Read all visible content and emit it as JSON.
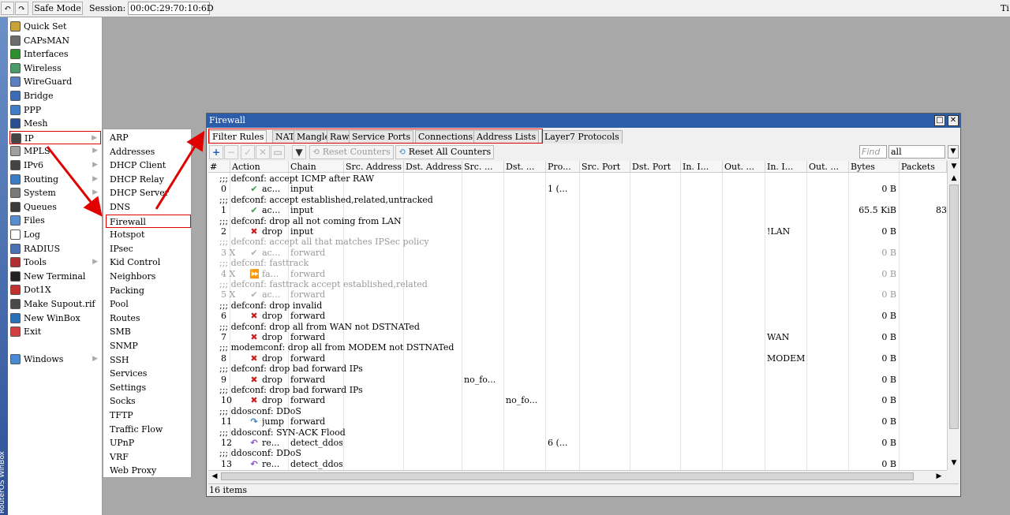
{
  "topbar": {
    "undo_icon": "↶",
    "redo_icon": "↷",
    "safe_mode": "Safe Mode",
    "session_label": "Session:",
    "session_value": "00:0C:29:70:10:6D",
    "right_text": "Ti"
  },
  "brand": "RouterOS WinBox",
  "sidebar": {
    "items": [
      {
        "label": "Quick Set",
        "icon": "quick-set-icon",
        "color": "#c9a33a",
        "arrow": false
      },
      {
        "label": "CAPsMAN",
        "icon": "capsman-icon",
        "color": "#6c6c6c",
        "arrow": false
      },
      {
        "label": "Interfaces",
        "icon": "interfaces-icon",
        "color": "#2f8f2f",
        "arrow": false
      },
      {
        "label": "Wireless",
        "icon": "wireless-icon",
        "color": "#4a9a6a",
        "arrow": false
      },
      {
        "label": "WireGuard",
        "icon": "wireguard-icon",
        "color": "#5b7fc0",
        "arrow": false
      },
      {
        "label": "Bridge",
        "icon": "bridge-icon",
        "color": "#3b6cb5",
        "arrow": false
      },
      {
        "label": "PPP",
        "icon": "ppp-icon",
        "color": "#3f7ec4",
        "arrow": false
      },
      {
        "label": "Mesh",
        "icon": "mesh-icon",
        "color": "#2a4f8f",
        "arrow": false
      },
      {
        "label": "IP",
        "icon": "ip-icon",
        "color": "#444444",
        "arrow": true
      },
      {
        "label": "MPLS",
        "icon": "mpls-icon",
        "color": "#a0a0a0",
        "arrow": true
      },
      {
        "label": "IPv6",
        "icon": "ipv6-icon",
        "color": "#444444",
        "arrow": true
      },
      {
        "label": "Routing",
        "icon": "routing-icon",
        "color": "#3b7dc4",
        "arrow": true
      },
      {
        "label": "System",
        "icon": "system-icon",
        "color": "#7a7a7a",
        "arrow": true
      },
      {
        "label": "Queues",
        "icon": "queues-icon",
        "color": "#3a3a3a",
        "arrow": false
      },
      {
        "label": "Files",
        "icon": "files-icon",
        "color": "#5a8cd0",
        "arrow": false
      },
      {
        "label": "Log",
        "icon": "log-icon",
        "color": "#ffffff",
        "arrow": false
      },
      {
        "label": "RADIUS",
        "icon": "radius-icon",
        "color": "#4b6fb0",
        "arrow": false
      },
      {
        "label": "Tools",
        "icon": "tools-icon",
        "color": "#b03030",
        "arrow": true
      },
      {
        "label": "New Terminal",
        "icon": "terminal-icon",
        "color": "#222222",
        "arrow": false
      },
      {
        "label": "Dot1X",
        "icon": "dot1x-icon",
        "color": "#c03030",
        "arrow": false
      },
      {
        "label": "Make Supout.rif",
        "icon": "supout-icon",
        "color": "#4a4a4a",
        "arrow": false
      },
      {
        "label": "New WinBox",
        "icon": "winbox-icon",
        "color": "#2a6fb8",
        "arrow": false
      },
      {
        "label": "Exit",
        "icon": "exit-icon",
        "color": "#d04040",
        "arrow": false
      }
    ],
    "windows_label": "Windows",
    "windows_icon": "windows-icon"
  },
  "submenu": {
    "items": [
      "ARP",
      "Addresses",
      "DHCP Client",
      "DHCP Relay",
      "DHCP Server",
      "DNS",
      "Firewall",
      "Hotspot",
      "IPsec",
      "Kid Control",
      "Neighbors",
      "Packing",
      "Pool",
      "Routes",
      "SMB",
      "SNMP",
      "SSH",
      "Services",
      "Settings",
      "Socks",
      "TFTP",
      "Traffic Flow",
      "UPnP",
      "VRF",
      "Web Proxy"
    ]
  },
  "firewall": {
    "title": "Firewall",
    "tabs": [
      "Filter Rules",
      "NAT",
      "Mangle",
      "Raw",
      "Service Ports",
      "Connections",
      "Address Lists",
      "Layer7 Protocols"
    ],
    "active_tab": "Filter Rules",
    "toolbar": {
      "reset_counters": "Reset Counters",
      "reset_all_counters": "Reset All Counters",
      "find_placeholder": "Find",
      "filter_value": "all"
    },
    "columns": [
      "#",
      "Action",
      "Chain",
      "Src. Address",
      "Dst. Address",
      "Src. ...",
      "Dst. ...",
      "Pro...",
      "Src. Port",
      "Dst. Port",
      "In. I...",
      "Out. ...",
      "In. I...",
      "Out. ...",
      "Bytes",
      "Packets"
    ],
    "rows": [
      {
        "comment": ";;; defconf: accept ICMP after RAW",
        "num": "0",
        "action": "ac...",
        "action_icon": "check-icon",
        "chain": "input",
        "src_addr_list": "",
        "dst_addr_list": "",
        "proto": "1 (...",
        "in_if_list": "",
        "bytes": "0 B",
        "packets": "",
        "disabled": false
      },
      {
        "comment": ";;; defconf: accept established,related,untracked",
        "num": "1",
        "action": "ac...",
        "action_icon": "check-icon",
        "chain": "input",
        "src_addr_list": "",
        "dst_addr_list": "",
        "proto": "",
        "in_if_list": "",
        "bytes": "65.5 KiB",
        "packets": "83",
        "disabled": false
      },
      {
        "comment": ";;; defconf: drop all not coming from LAN",
        "num": "2",
        "action": "drop",
        "action_icon": "x-icon",
        "chain": "input",
        "src_addr_list": "",
        "dst_addr_list": "",
        "proto": "",
        "in_if_list": "!LAN",
        "bytes": "0 B",
        "packets": "",
        "disabled": false
      },
      {
        "comment": ";;; defconf: accept all that matches IPSec policy",
        "num": "3 X",
        "action": "ac...",
        "action_icon": "check-icon",
        "chain": "forward",
        "src_addr_list": "",
        "dst_addr_list": "",
        "proto": "",
        "in_if_list": "",
        "bytes": "0 B",
        "packets": "",
        "disabled": true
      },
      {
        "comment": ";;; defconf: fasttrack",
        "num": "4 X",
        "action": "fa...",
        "action_icon": "fasttrack-icon",
        "chain": "forward",
        "src_addr_list": "",
        "dst_addr_list": "",
        "proto": "",
        "in_if_list": "",
        "bytes": "0 B",
        "packets": "",
        "disabled": true
      },
      {
        "comment": ";;; defconf: fasttrack accept established,related",
        "num": "5 X",
        "action": "ac...",
        "action_icon": "check-icon",
        "chain": "forward",
        "src_addr_list": "",
        "dst_addr_list": "",
        "proto": "",
        "in_if_list": "",
        "bytes": "0 B",
        "packets": "",
        "disabled": true
      },
      {
        "comment": ";;; defconf: drop invalid",
        "num": "6",
        "action": "drop",
        "action_icon": "x-icon",
        "chain": "forward",
        "src_addr_list": "",
        "dst_addr_list": "",
        "proto": "",
        "in_if_list": "",
        "bytes": "0 B",
        "packets": "",
        "disabled": false
      },
      {
        "comment": ";;; defconf: drop all from WAN not DSTNATed",
        "num": "7",
        "action": "drop",
        "action_icon": "x-icon",
        "chain": "forward",
        "src_addr_list": "",
        "dst_addr_list": "",
        "proto": "",
        "in_if_list": "WAN",
        "bytes": "0 B",
        "packets": "",
        "disabled": false
      },
      {
        "comment": ";;; modemconf: drop all from MODEM not DSTNATed",
        "num": "8",
        "action": "drop",
        "action_icon": "x-icon",
        "chain": "forward",
        "src_addr_list": "",
        "dst_addr_list": "",
        "proto": "",
        "in_if_list": "MODEM",
        "bytes": "0 B",
        "packets": "",
        "disabled": false
      },
      {
        "comment": ";;; defconf: drop bad forward IPs",
        "num": "9",
        "action": "drop",
        "action_icon": "x-icon",
        "chain": "forward",
        "src_addr_list": "no_fo...",
        "dst_addr_list": "",
        "proto": "",
        "in_if_list": "",
        "bytes": "0 B",
        "packets": "",
        "disabled": false
      },
      {
        "comment": ";;; defconf: drop bad forward IPs",
        "num": "10",
        "action": "drop",
        "action_icon": "x-icon",
        "chain": "forward",
        "src_addr_list": "",
        "dst_addr_list": "no_fo...",
        "proto": "",
        "in_if_list": "",
        "bytes": "0 B",
        "packets": "",
        "disabled": false
      },
      {
        "comment": ";;; ddosconf: DDoS",
        "num": "11",
        "action": "jump",
        "action_icon": "jump-icon",
        "chain": "forward",
        "src_addr_list": "",
        "dst_addr_list": "",
        "proto": "",
        "in_if_list": "",
        "bytes": "0 B",
        "packets": "",
        "disabled": false
      },
      {
        "comment": ";;; ddosconf: SYN-ACK Flood",
        "num": "12",
        "action": "re...",
        "action_icon": "return-icon",
        "chain": "detect_ddos",
        "src_addr_list": "",
        "dst_addr_list": "",
        "proto": "6 (...",
        "in_if_list": "",
        "bytes": "0 B",
        "packets": "",
        "disabled": false
      },
      {
        "comment": ";;; ddosconf: DDoS",
        "num": "13",
        "action": "re...",
        "action_icon": "return-icon",
        "chain": "detect_ddos",
        "src_addr_list": "",
        "dst_addr_list": "",
        "proto": "",
        "in_if_list": "",
        "bytes": "0 B",
        "packets": "",
        "disabled": false
      }
    ],
    "status": "16 items"
  },
  "colors": {
    "title_bar": "#2c5da8",
    "highlight_red": "#e00000",
    "accept_green": "#2ea043",
    "drop_red": "#cc1f1f",
    "jump_blue": "#2f7fc0",
    "return_purple": "#8a4fc4"
  }
}
